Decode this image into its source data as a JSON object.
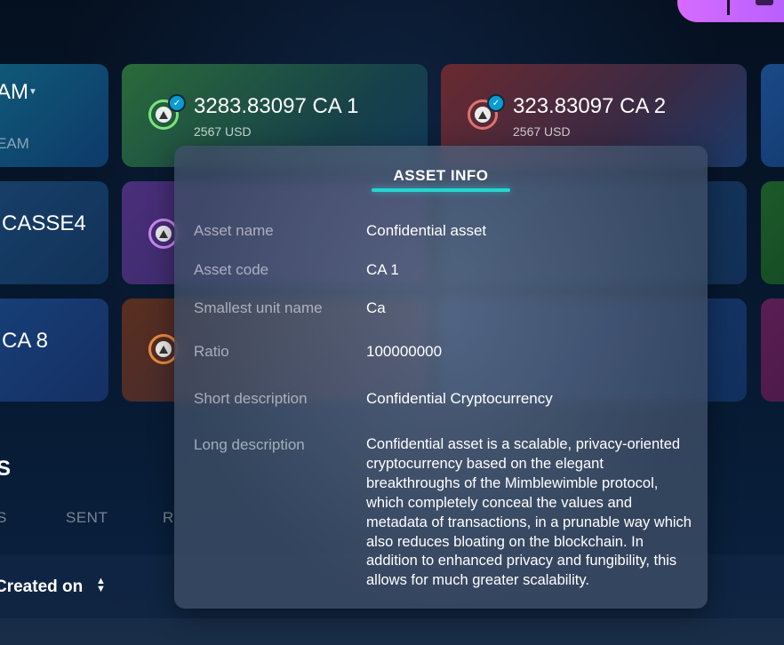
{
  "cards": [
    {
      "amount": "AM",
      "usd": "EAM",
      "has_dropdown": true,
      "color": "#0e4d6a"
    },
    {
      "amount": "3283.83097 CA 1",
      "usd": "2567 USD",
      "ring_color": "#7be37b",
      "color": "#1f5a3a"
    },
    {
      "amount": "323.83097 CA 2",
      "usd": "2567 USD",
      "ring_color": "#e2726b",
      "color": "#5a2a2e"
    },
    {
      "amount": "CASSE4",
      "color": "#173a5e"
    },
    {
      "amount": "",
      "ring_color": "#c98af0",
      "color": "#3e2a66"
    },
    {
      "amount": "CA 8",
      "color": "#173f73"
    },
    {
      "amount": "",
      "ring_color": "#f0893c",
      "color": "#5a2e1e"
    }
  ],
  "section": {
    "title": "S"
  },
  "tabs": [
    "S",
    "SENT",
    "R"
  ],
  "table": {
    "sort_column": "Created on"
  },
  "modal": {
    "title": "ASSET INFO",
    "fields": [
      {
        "label": "Asset name",
        "value": "Confidential asset"
      },
      {
        "label": "Asset code",
        "value": "CA 1"
      },
      {
        "label": "Smallest unit name",
        "value": "Ca"
      },
      {
        "label": "Ratio",
        "value": "100000000"
      },
      {
        "label": "Short description",
        "value": "Confidential Cryptocurrency"
      },
      {
        "label": "Long description",
        "value": "Confidential asset is a scalable, privacy-oriented cryptocurrency based on the elegant breakthroughs of the Mimblewimble protocol, which completely conceal the values and metadata of transactions, in a prunable way which also reduces bloating on the blockchain. In addition to enhanced privacy and fungibility, this allows for much greater scalability."
      }
    ]
  },
  "colors": {
    "accent": "#24d6d0",
    "primary_button": "#d56bff"
  }
}
